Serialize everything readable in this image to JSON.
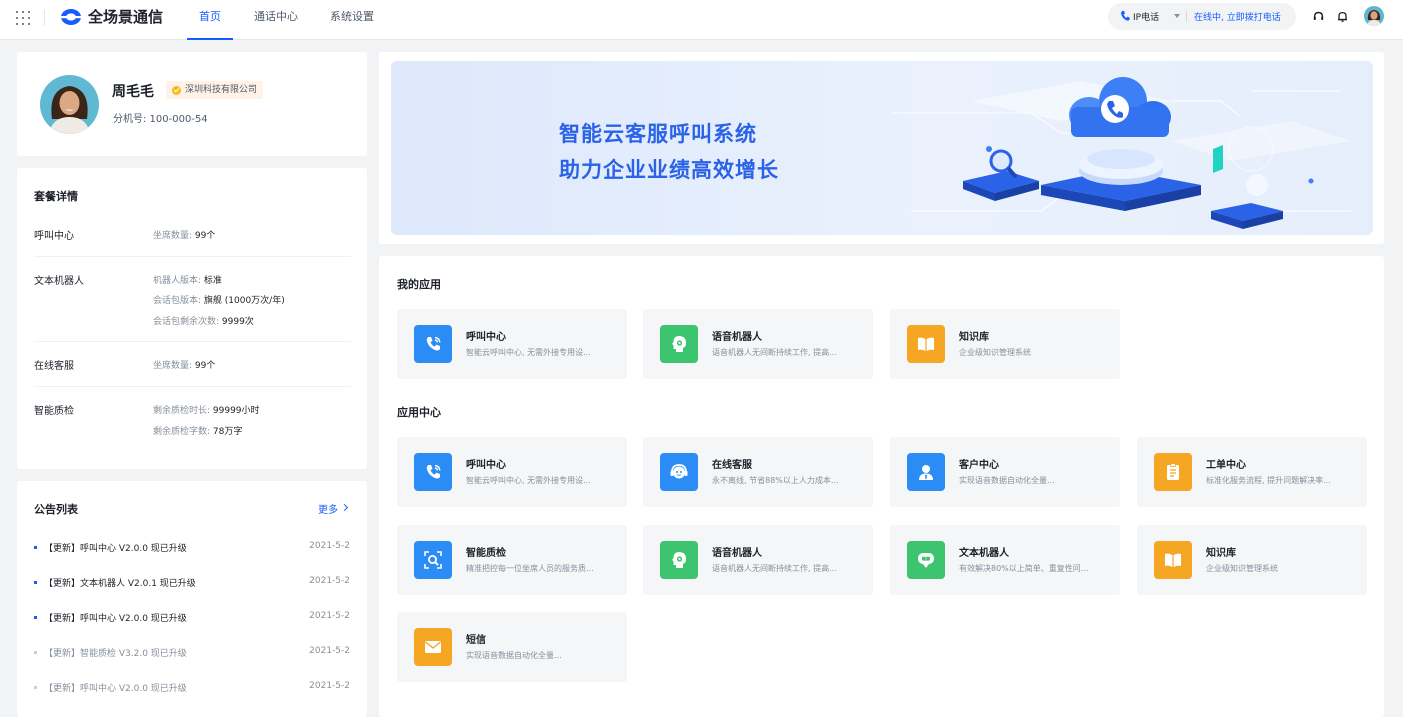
{
  "app": {
    "title": "全场景通信"
  },
  "nav": {
    "items": [
      "首页",
      "通话中心",
      "系统设置"
    ]
  },
  "phone_widget": {
    "label": "IP电话",
    "status": "在线中, 立即拨打电话"
  },
  "profile": {
    "name": "周毛毛",
    "company": "深圳科技有限公司",
    "extension": "分机号: 100-000-54"
  },
  "package": {
    "title": "套餐详情",
    "rows": [
      {
        "label": "呼叫中心",
        "lines": [
          {
            "k": "坐席数量: ",
            "v": "99个"
          }
        ]
      },
      {
        "label": "文本机器人",
        "lines": [
          {
            "k": "机器人版本: ",
            "v": "标准"
          },
          {
            "k": "会话包版本: ",
            "v": "旗舰 (1000万次/年)"
          },
          {
            "k": "会话包剩余次数: ",
            "v": "9999次"
          }
        ]
      },
      {
        "label": "在线客服",
        "lines": [
          {
            "k": "坐席数量: ",
            "v": "99个"
          }
        ]
      },
      {
        "label": "智能质检",
        "lines": [
          {
            "k": "剩余质检时长: ",
            "v": "99999小时"
          },
          {
            "k": "剩余质检字数: ",
            "v": "78万字"
          }
        ]
      }
    ]
  },
  "notices": {
    "title": "公告列表",
    "more": "更多",
    "items": [
      {
        "text": "【更新】呼叫中心 V2.0.0 现已升级",
        "date": "2021-5-2"
      },
      {
        "text": "【更新】文本机器人 V2.0.1 现已升级",
        "date": "2021-5-2"
      },
      {
        "text": "【更新】呼叫中心 V2.0.0 现已升级",
        "date": "2021-5-2"
      },
      {
        "text": "【更新】智能质检 V3.2.0 现已升级",
        "date": "2021-5-2"
      },
      {
        "text": "【更新】呼叫中心 V2.0.0 现已升级",
        "date": "2021-5-2"
      }
    ]
  },
  "banner": {
    "line1": "智能云客服呼叫系统",
    "line2": "助力企业业绩高效增长"
  },
  "my_apps": {
    "title": "我的应用",
    "items": [
      {
        "name": "呼叫中心",
        "desc": "智能云呼叫中心, 无需外接专用设...",
        "icon": "phone-icon",
        "color": "#2b8cf6"
      },
      {
        "name": "语音机器人",
        "desc": "语音机器人无间断持续工作, 提高...",
        "icon": "voice-robot-icon",
        "color": "#3cc46f"
      },
      {
        "name": "知识库",
        "desc": "企业级知识管理系统",
        "icon": "book-icon",
        "color": "#f5a623"
      }
    ]
  },
  "app_center": {
    "title": "应用中心",
    "items": [
      {
        "name": "呼叫中心",
        "desc": "智能云呼叫中心, 无需外接专用设...",
        "icon": "phone-icon",
        "color": "#2b8cf6"
      },
      {
        "name": "在线客服",
        "desc": "永不离线, 节省88%以上人力成本...",
        "icon": "headset-icon",
        "color": "#2b8cf6"
      },
      {
        "name": "客户中心",
        "desc": "实现语音数据自动化全量...",
        "icon": "user-icon",
        "color": "#2b8cf6"
      },
      {
        "name": "工单中心",
        "desc": "标准化服务流程, 提升问题解决率...",
        "icon": "ticket-icon",
        "color": "#f5a623"
      },
      {
        "name": "智能质检",
        "desc": "精准把控每一位坐席人员的服务质...",
        "icon": "inspect-icon",
        "color": "#2b8cf6"
      },
      {
        "name": "语音机器人",
        "desc": "语音机器人无间断持续工作, 提高...",
        "icon": "voice-robot-icon",
        "color": "#3cc46f"
      },
      {
        "name": "文本机器人",
        "desc": "有效解决80%以上简单、重复性问...",
        "icon": "text-robot-icon",
        "color": "#3cc46f"
      },
      {
        "name": "知识库",
        "desc": "企业级知识管理系统",
        "icon": "book-icon",
        "color": "#f5a623"
      },
      {
        "name": "短信",
        "desc": "实现语音数据自动化全量...",
        "icon": "mail-icon",
        "color": "#f5a623"
      }
    ]
  }
}
